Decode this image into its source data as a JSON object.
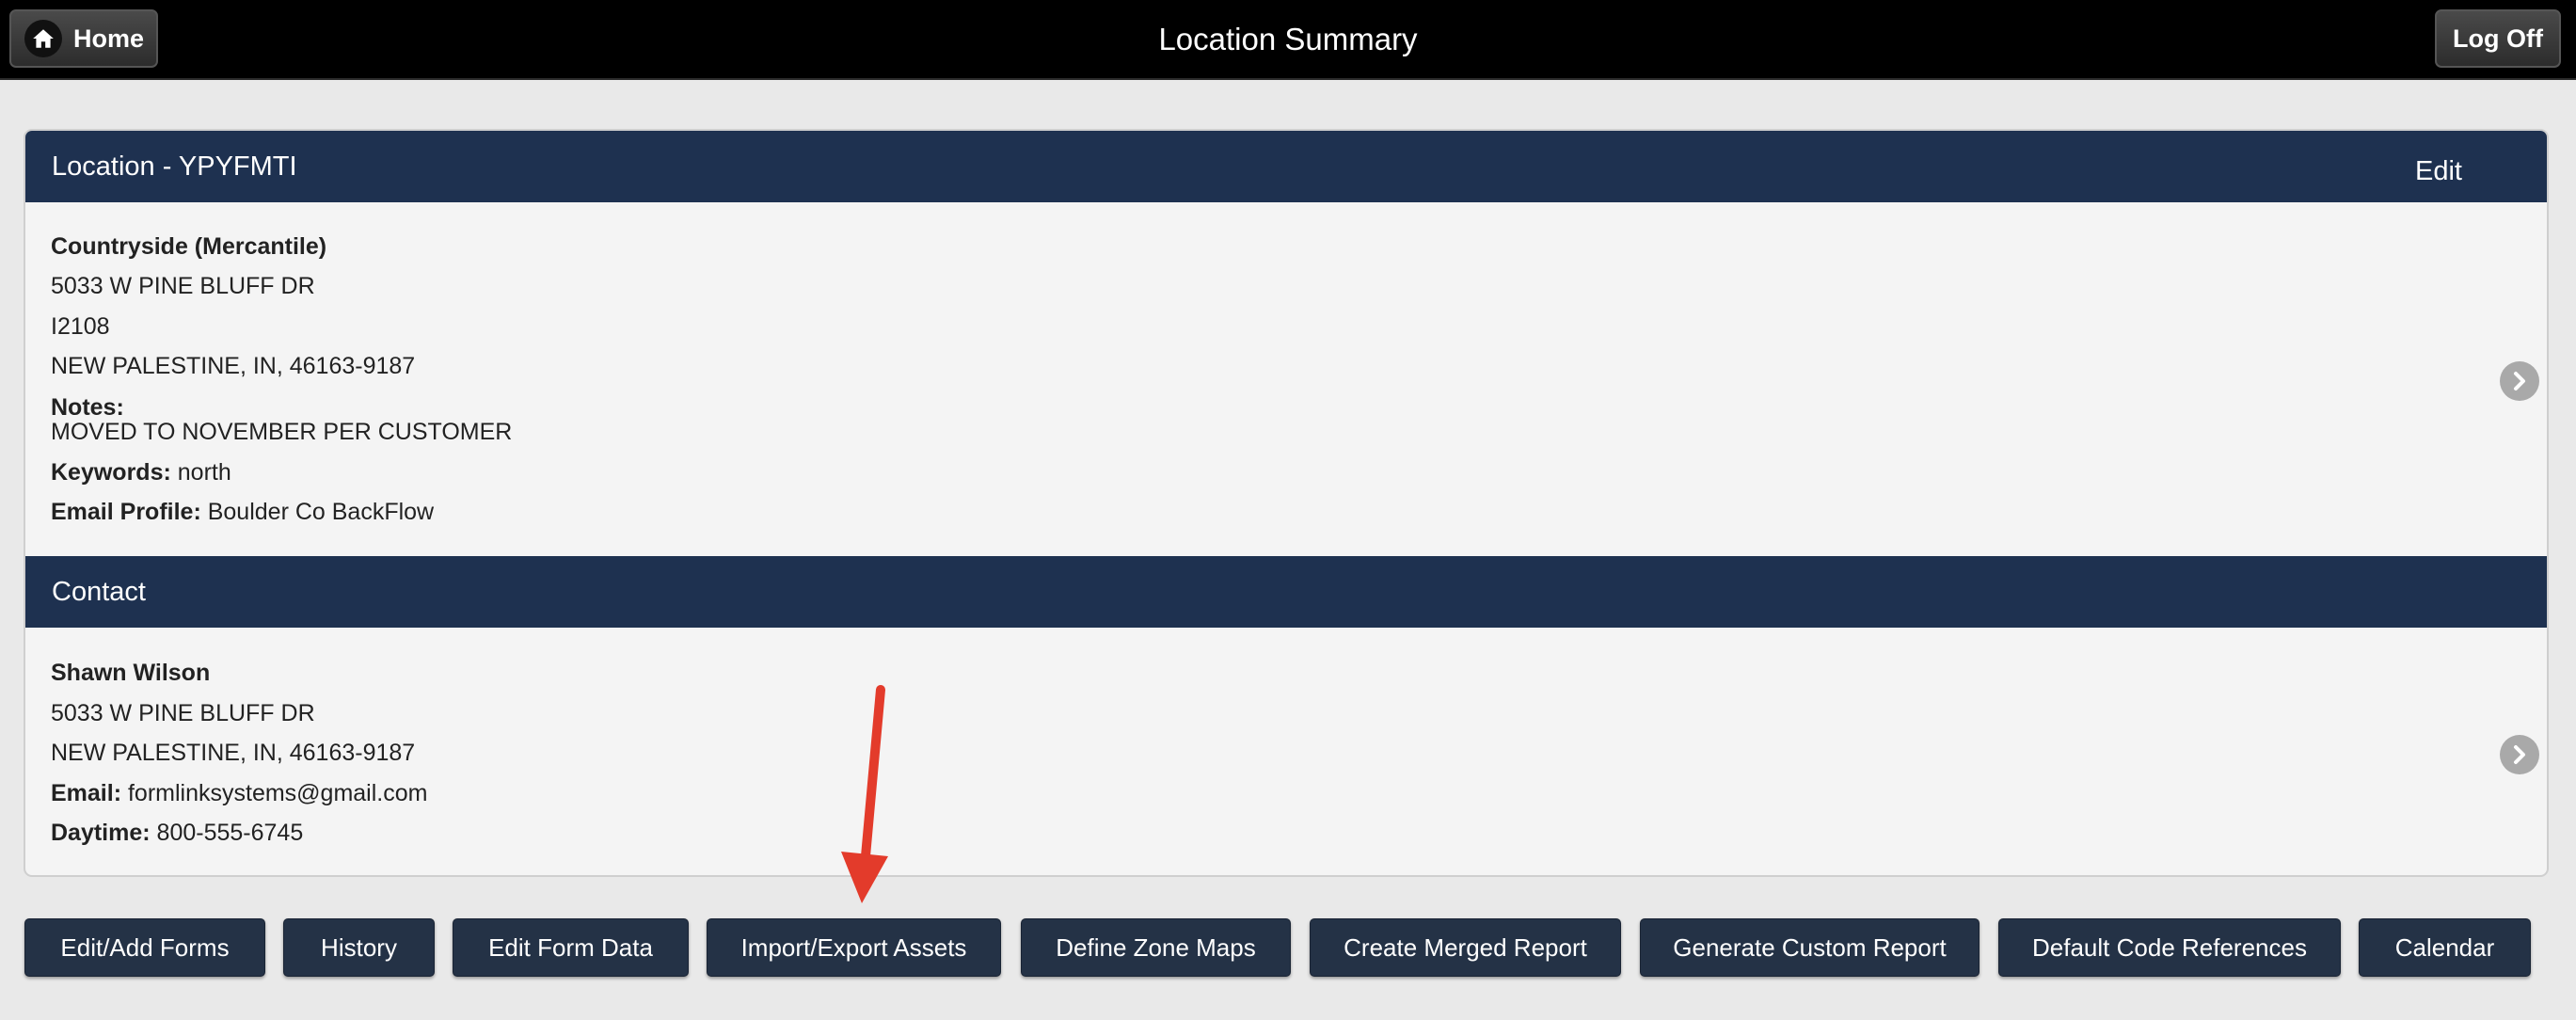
{
  "header": {
    "title": "Location Summary",
    "home_label": "Home",
    "logoff_label": "Log Off"
  },
  "location": {
    "section_title": "Location - YPYFMTI",
    "edit_label": "Edit",
    "name": "Countryside  (Mercantile)",
    "address1": "5033 W PINE BLUFF DR",
    "address2": "I2108",
    "city_line": "NEW PALESTINE, IN, 46163-9187",
    "notes_label": "Notes:",
    "notes_value": "MOVED TO NOVEMBER PER CUSTOMER",
    "keywords_label": "Keywords:",
    "keywords_value": "north",
    "email_profile_label": "Email Profile:",
    "email_profile_value": "Boulder Co BackFlow"
  },
  "contact": {
    "section_title": "Contact",
    "name": "Shawn Wilson",
    "address1": "5033 W PINE BLUFF DR",
    "city_line": "NEW PALESTINE, IN, 46163-9187",
    "email_label": "Email:",
    "email_value": "formlinksystems@gmail.com",
    "daytime_label": "Daytime:",
    "daytime_value": "800-555-6745"
  },
  "actions": [
    "Edit/Add Forms",
    "History",
    "Edit Form Data",
    "Import/Export Assets",
    "Define Zone Maps",
    "Create Merged Report",
    "Generate Custom Report",
    "Default Code References",
    "Calendar"
  ],
  "colors": {
    "header_bg": "#000000",
    "section_bg": "#1e3150",
    "button_bg": "#243246",
    "annotation_arrow": "#e33b2b"
  }
}
